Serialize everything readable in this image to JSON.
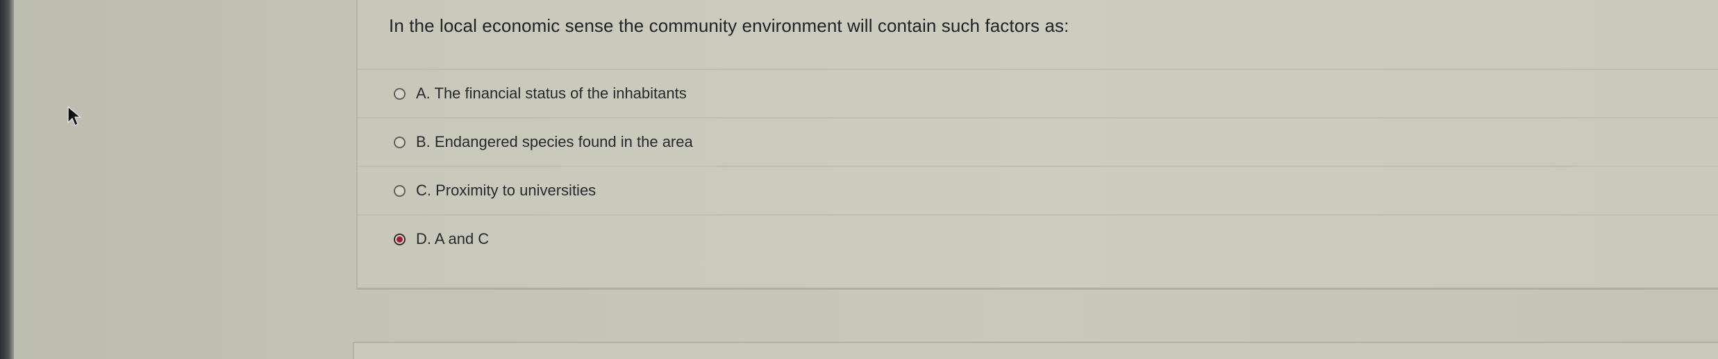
{
  "question": {
    "text": "In the local economic sense the community environment will contain such factors as:"
  },
  "options": [
    {
      "label": "A. The financial status of the inhabitants",
      "selected": false
    },
    {
      "label": "B. Endangered species found in the area",
      "selected": false
    },
    {
      "label": "C. Proximity to universities",
      "selected": false
    },
    {
      "label": "D. A and C",
      "selected": true
    }
  ],
  "colors": {
    "selected_radio": "#a31f38",
    "background": "#c6c5b7",
    "text": "#1f2226"
  }
}
